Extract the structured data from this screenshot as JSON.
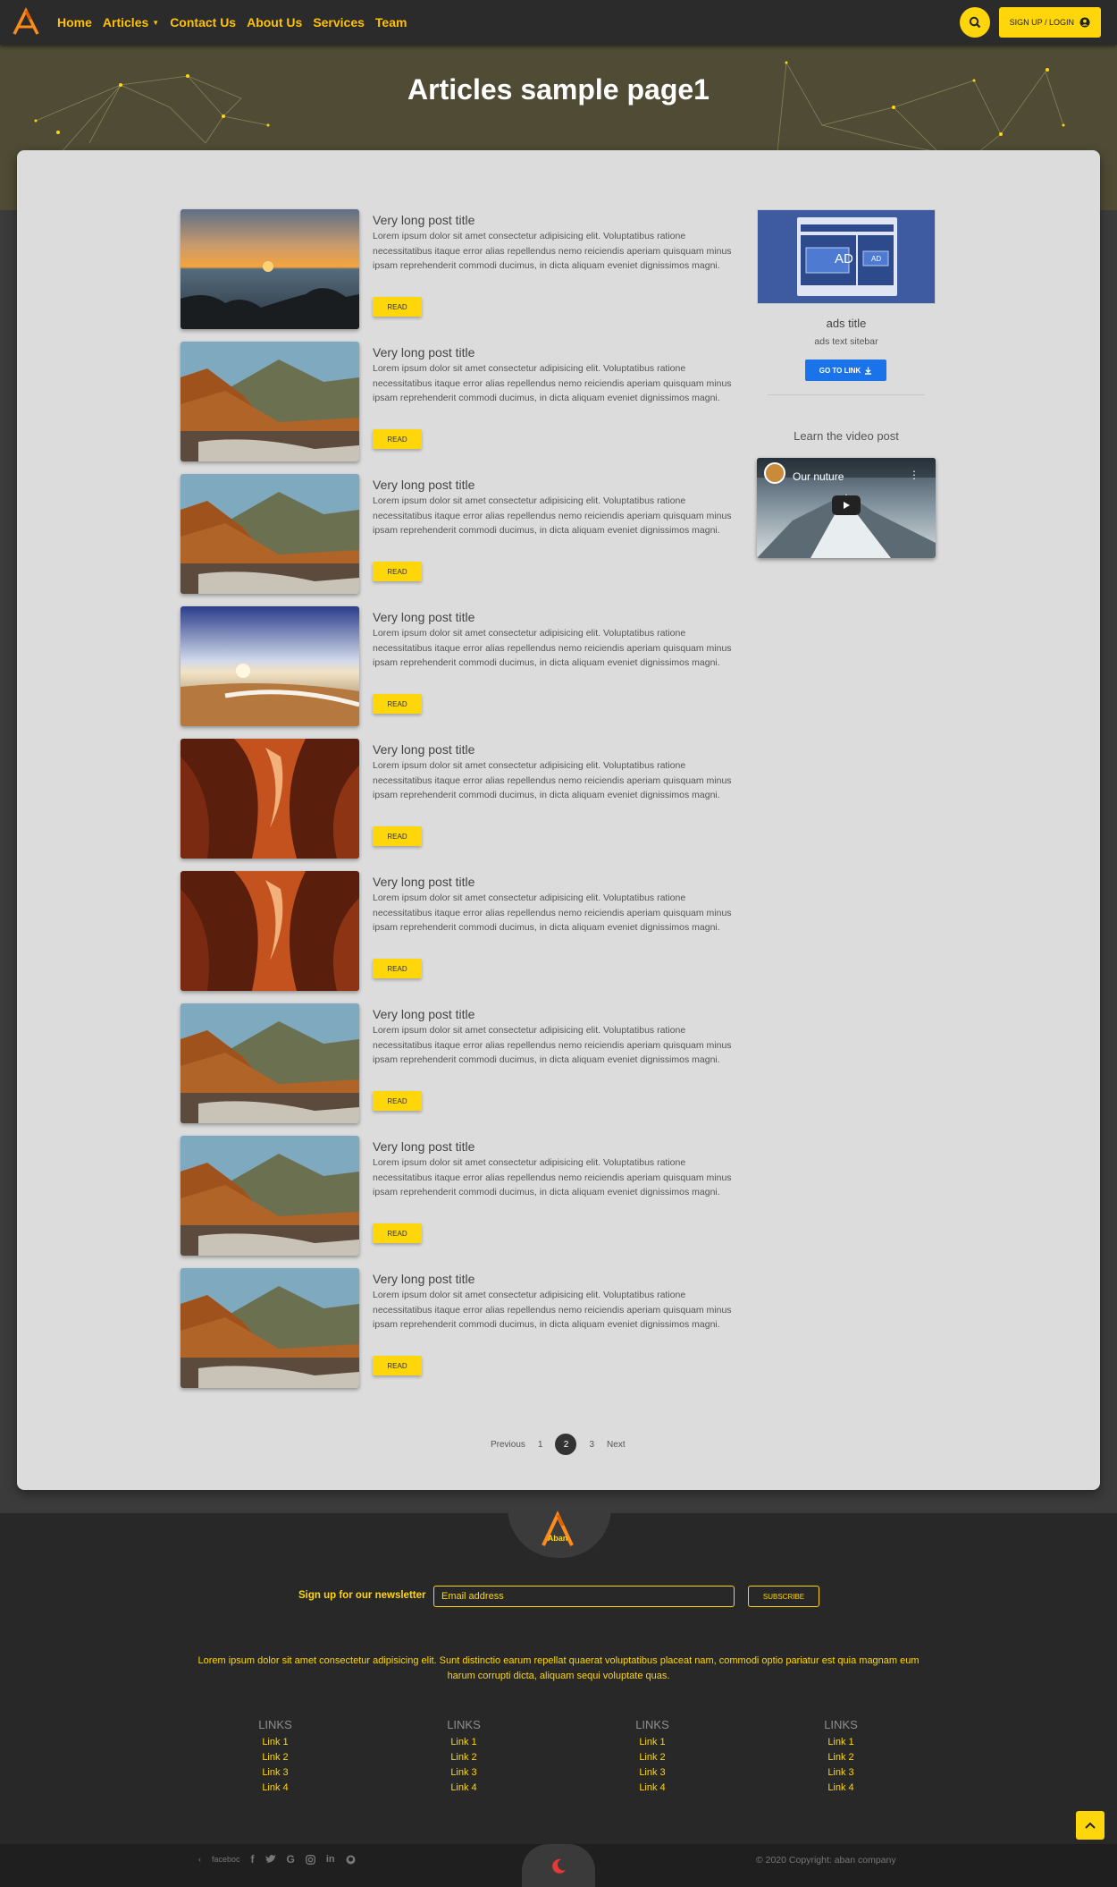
{
  "nav": {
    "items": [
      "Home",
      "Articles",
      "Contact Us",
      "About Us",
      "Services",
      "Team"
    ],
    "login_label": "SIGN UP / LOGIN",
    "accent": "#ffc107"
  },
  "hero": {
    "title": "Articles sample page1"
  },
  "posts": [
    {
      "title": "Very long post title",
      "text": "Lorem ipsum dolor sit amet consectetur adipisicing elit. Voluptatibus ratione necessitatibus itaque error alias repellendus nemo reiciendis aperiam quisquam minus ipsam reprehenderit commodi ducimus, in dicta aliquam eveniet dignissimos magni.",
      "read": "READ",
      "image": "sunset-sea"
    },
    {
      "title": "Very long post title",
      "text": "Lorem ipsum dolor sit amet consectetur adipisicing elit. Voluptatibus ratione necessitatibus itaque error alias repellendus nemo reiciendis aperiam quisquam minus ipsam reprehenderit commodi ducimus, in dicta aliquam eveniet dignissimos magni.",
      "read": "READ",
      "image": "autumn-mountain"
    },
    {
      "title": "Very long post title",
      "text": "Lorem ipsum dolor sit amet consectetur adipisicing elit. Voluptatibus ratione necessitatibus itaque error alias repellendus nemo reiciendis aperiam quisquam minus ipsam reprehenderit commodi ducimus, in dicta aliquam eveniet dignissimos magni.",
      "read": "READ",
      "image": "autumn-mountain"
    },
    {
      "title": "Very long post title",
      "text": "Lorem ipsum dolor sit amet consectetur adipisicing elit. Voluptatibus ratione necessitatibus itaque error alias repellendus nemo reiciendis aperiam quisquam minus ipsam reprehenderit commodi ducimus, in dicta aliquam eveniet dignissimos magni.",
      "read": "READ",
      "image": "beach-sky"
    },
    {
      "title": "Very long post title",
      "text": "Lorem ipsum dolor sit amet consectetur adipisicing elit. Voluptatibus ratione necessitatibus itaque error alias repellendus nemo reiciendis aperiam quisquam minus ipsam reprehenderit commodi ducimus, in dicta aliquam eveniet dignissimos magni.",
      "read": "READ",
      "image": "canyon"
    },
    {
      "title": "Very long post title",
      "text": "Lorem ipsum dolor sit amet consectetur adipisicing elit. Voluptatibus ratione necessitatibus itaque error alias repellendus nemo reiciendis aperiam quisquam minus ipsam reprehenderit commodi ducimus, in dicta aliquam eveniet dignissimos magni.",
      "read": "READ",
      "image": "canyon"
    },
    {
      "title": "Very long post title",
      "text": "Lorem ipsum dolor sit amet consectetur adipisicing elit. Voluptatibus ratione necessitatibus itaque error alias repellendus nemo reiciendis aperiam quisquam minus ipsam reprehenderit commodi ducimus, in dicta aliquam eveniet dignissimos magni.",
      "read": "READ",
      "image": "autumn-mountain"
    },
    {
      "title": "Very long post title",
      "text": "Lorem ipsum dolor sit amet consectetur adipisicing elit. Voluptatibus ratione necessitatibus itaque error alias repellendus nemo reiciendis aperiam quisquam minus ipsam reprehenderit commodi ducimus, in dicta aliquam eveniet dignissimos magni.",
      "read": "READ",
      "image": "autumn-mountain"
    },
    {
      "title": "Very long post title",
      "text": "Lorem ipsum dolor sit amet consectetur adipisicing elit. Voluptatibus ratione necessitatibus itaque error alias repellendus nemo reiciendis aperiam quisquam minus ipsam reprehenderit commodi ducimus, in dicta aliquam eveniet dignissimos magni.",
      "read": "READ",
      "image": "autumn-mountain"
    }
  ],
  "sidebar": {
    "ad_badge": "AD",
    "ad_badge_small": "AD",
    "ads_title": "ads title",
    "ads_text": "ads text sitebar",
    "goto_label": "GO TO LINK",
    "video_heading": "Learn the video post",
    "video_title": "Our nuture"
  },
  "pagination": {
    "prev": "Previous",
    "pages": [
      "1",
      "2",
      "3"
    ],
    "active": "2",
    "next": "Next"
  },
  "footer": {
    "newsletter_label": "Sign up for our newsletter",
    "email_placeholder": "Email address",
    "subscribe_label": "SUBSCRIBE",
    "lorem": "Lorem ipsum dolor sit amet consectetur adipisicing elit. Sunt distinctio earum repellat quaerat voluptatibus placeat nam, commodi optio pariatur est quia magnam eum harum corrupti dicta, aliquam sequi voluptate quas.",
    "link_columns": [
      {
        "heading": "LINKS",
        "items": [
          "Link 1",
          "Link 2",
          "Link 3",
          "Link 4"
        ]
      },
      {
        "heading": "LINKS",
        "items": [
          "Link 1",
          "Link 2",
          "Link 3",
          "Link 4"
        ]
      },
      {
        "heading": "LINKS",
        "items": [
          "Link 1",
          "Link 2",
          "Link 3",
          "Link 4"
        ]
      },
      {
        "heading": "LINKS",
        "items": [
          "Link 1",
          "Link 2",
          "Link 3",
          "Link 4"
        ]
      }
    ],
    "logo_text": "Aban",
    "social_text": "faceboc",
    "copyright": "© 2020 Copyright: aban company"
  }
}
